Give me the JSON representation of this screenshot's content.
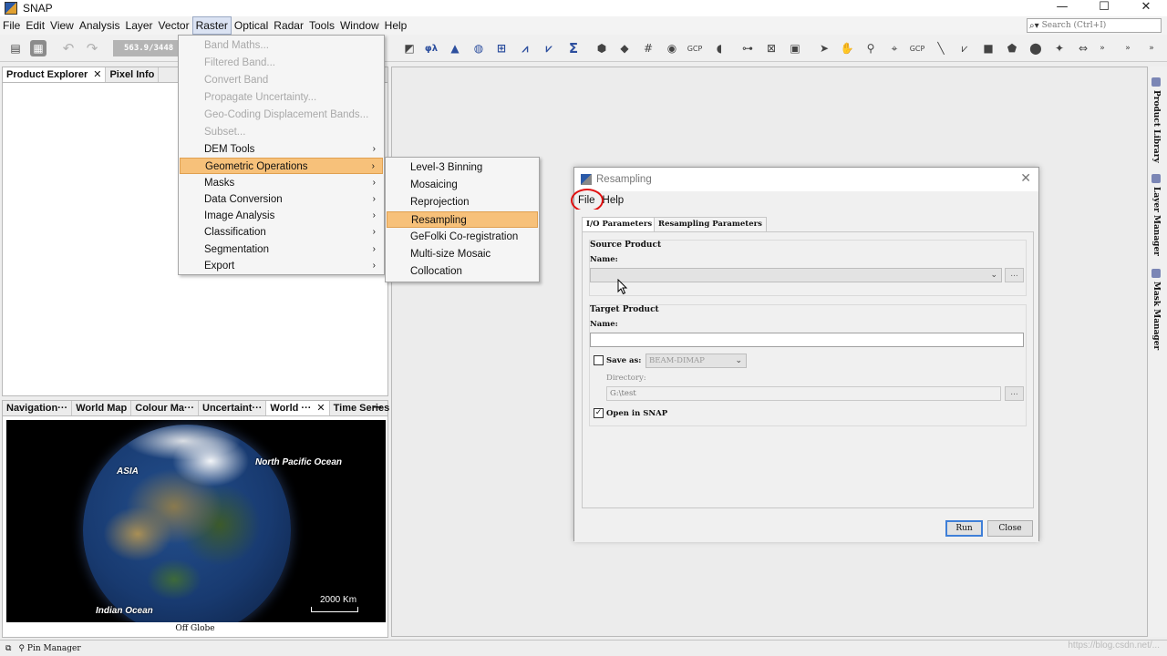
{
  "app": {
    "title": "SNAP"
  },
  "window_buttons": {
    "minimize": "—",
    "maximize": "☐",
    "close": "✕"
  },
  "menubar": {
    "items": [
      "File",
      "Edit",
      "View",
      "Analysis",
      "Layer",
      "Vector",
      "Raster",
      "Optical",
      "Radar",
      "Tools",
      "Window",
      "Help"
    ],
    "active": "Raster"
  },
  "search": {
    "placeholder": "Search (Ctrl+I)"
  },
  "toolbar": {
    "coordinate_readout": "563.9/3448"
  },
  "panels": {
    "product_explorer": {
      "tabs": [
        "Product Explorer",
        "Pixel Info"
      ]
    },
    "navigation": {
      "tabs": [
        "Navigation···",
        "World Map",
        "Colour Ma···",
        "Uncertaint···",
        "World ···",
        "Time Series"
      ],
      "active_tab": "World ···",
      "map_labels": {
        "asia": "ASIA",
        "north_pacific": "North Pacific Ocean",
        "indian": "Indian Ocean"
      },
      "scale": "2000 Km",
      "caption": "Off Globe"
    }
  },
  "right_strip": {
    "tabs": [
      "Product Library",
      "Layer Manager",
      "Mask Manager"
    ]
  },
  "statusbar": {
    "text": "Pin Manager",
    "watermark": "https://blog.csdn.net/..."
  },
  "raster_menu": {
    "items": [
      {
        "label": "Band Maths...",
        "disabled": true,
        "submenu": false
      },
      {
        "label": "Filtered Band...",
        "disabled": true,
        "submenu": false
      },
      {
        "label": "Convert Band",
        "disabled": true,
        "submenu": false
      },
      {
        "label": "Propagate Uncertainty...",
        "disabled": true,
        "submenu": false
      },
      {
        "label": "Geo-Coding Displacement Bands...",
        "disabled": true,
        "submenu": false
      },
      {
        "label": "Subset...",
        "disabled": true,
        "submenu": false
      },
      {
        "label": "DEM Tools",
        "disabled": false,
        "submenu": true
      },
      {
        "label": "Geometric Operations",
        "disabled": false,
        "submenu": true,
        "highlighted": true
      },
      {
        "label": "Masks",
        "disabled": false,
        "submenu": true
      },
      {
        "label": "Data Conversion",
        "disabled": false,
        "submenu": true
      },
      {
        "label": "Image Analysis",
        "disabled": false,
        "submenu": true
      },
      {
        "label": "Classification",
        "disabled": false,
        "submenu": true
      },
      {
        "label": "Segmentation",
        "disabled": false,
        "submenu": true
      },
      {
        "label": "Export",
        "disabled": false,
        "submenu": true
      }
    ]
  },
  "geometric_submenu": {
    "items": [
      "Level-3 Binning",
      "Mosaicing",
      "Reprojection",
      "Resampling",
      "GeFolki Co-registration",
      "Multi-size Mosaic",
      "Collocation"
    ],
    "highlighted": "Resampling"
  },
  "dialog": {
    "title": "Resampling",
    "menu": [
      "File",
      "Help"
    ],
    "tabs": [
      "I/O Parameters",
      "Resampling Parameters"
    ],
    "active_tab": "I/O Parameters",
    "source_product": {
      "legend": "Source Product",
      "name_label": "Name:",
      "name_value": ""
    },
    "target_product": {
      "legend": "Target Product",
      "name_label": "Name:",
      "name_value": "",
      "save_as_label": "Save as:",
      "save_as_checked": false,
      "format_value": "BEAM-DIMAP",
      "directory_label": "Directory:",
      "directory_value": "G:\\test",
      "open_in_snap_label": "Open in SNAP",
      "open_in_snap_checked": true
    },
    "buttons": {
      "run": "Run",
      "close": "Close"
    },
    "ellipsis": "..."
  },
  "colors": {
    "menu_highlight": "#f7c17a",
    "annotation_circle": "#e01010",
    "default_button_border": "#3f7fd8"
  }
}
